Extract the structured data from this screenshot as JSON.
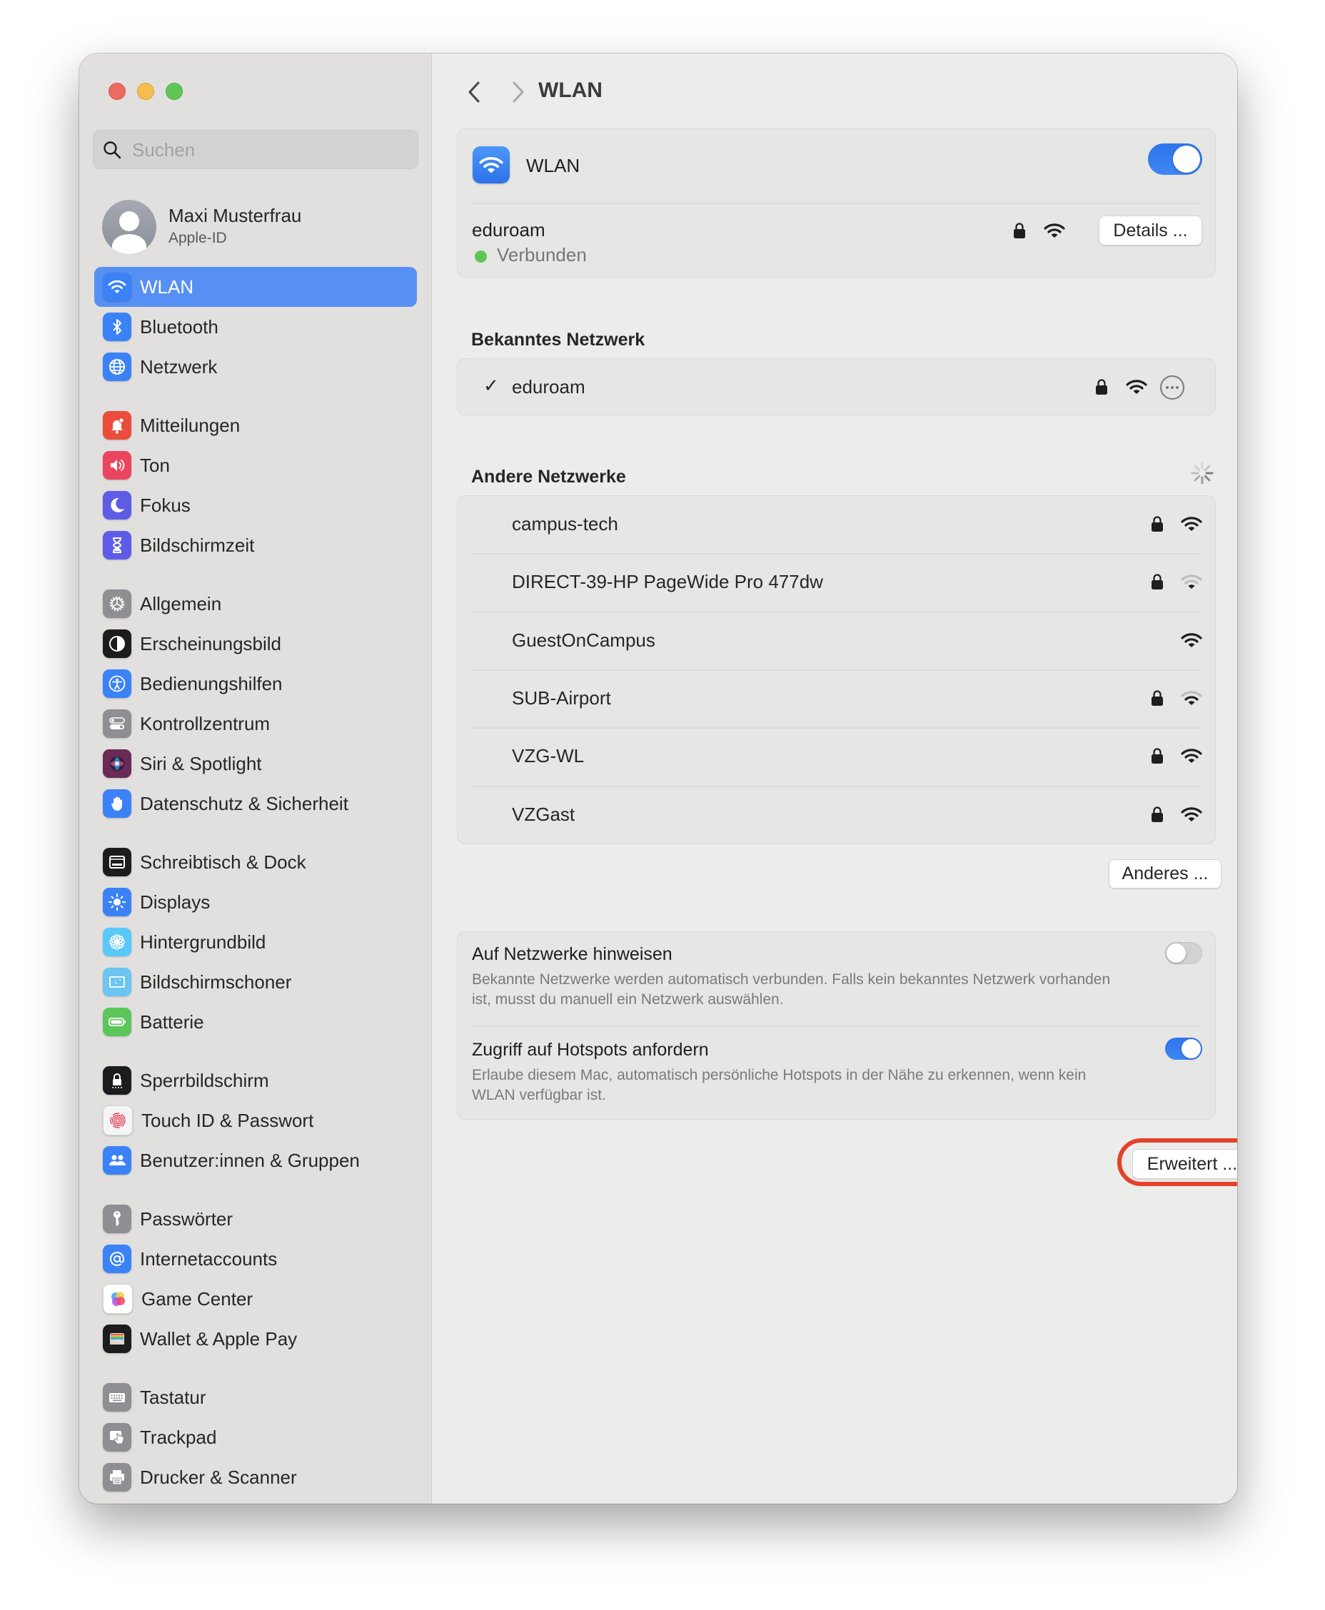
{
  "window": {
    "traffic_lights": [
      "close",
      "minimize",
      "zoom"
    ]
  },
  "sidebar": {
    "search_placeholder": "Suchen",
    "search_value": "",
    "profile": {
      "name": "Maxi Musterfrau",
      "subtitle": "Apple-ID"
    },
    "groups": [
      [
        {
          "label": "WLAN",
          "icon": "wifi-icon",
          "color": "#3B82F6",
          "selected": true
        },
        {
          "label": "Bluetooth",
          "icon": "bluetooth-icon",
          "color": "#3B82F6"
        },
        {
          "label": "Netzwerk",
          "icon": "globe-icon",
          "color": "#3B82F6"
        }
      ],
      [
        {
          "label": "Mitteilungen",
          "icon": "bell-icon",
          "color": "#EB4D3D"
        },
        {
          "label": "Ton",
          "icon": "speaker-icon",
          "color": "#EB4560"
        },
        {
          "label": "Fokus",
          "icon": "moon-icon",
          "color": "#5E5CE6"
        },
        {
          "label": "Bildschirmzeit",
          "icon": "hourglass-icon",
          "color": "#5E5CE6"
        }
      ],
      [
        {
          "label": "Allgemein",
          "icon": "gear-icon",
          "color": "#8E8E93"
        },
        {
          "label": "Erscheinungsbild",
          "icon": "appearance-icon",
          "color": "#1C1C1E"
        },
        {
          "label": "Bedienungshilfen",
          "icon": "accessibility-icon",
          "color": "#3B82F6"
        },
        {
          "label": "Kontrollzentrum",
          "icon": "control-center-icon",
          "color": "#8E8E93"
        },
        {
          "label": "Siri & Spotlight",
          "icon": "siri-icon",
          "color": "#6B2A55"
        },
        {
          "label": "Datenschutz & Sicherheit",
          "icon": "hand-icon",
          "color": "#3B82F6"
        }
      ],
      [
        {
          "label": "Schreibtisch & Dock",
          "icon": "dock-icon",
          "color": "#1C1C1E"
        },
        {
          "label": "Displays",
          "icon": "sun-icon",
          "color": "#3B82F6"
        },
        {
          "label": "Hintergrundbild",
          "icon": "flower-icon",
          "color": "#5AC8FA"
        },
        {
          "label": "Bildschirmschoner",
          "icon": "screensaver-icon",
          "color": "#6CC5F0"
        },
        {
          "label": "Batterie",
          "icon": "battery-icon",
          "color": "#5DC65A"
        }
      ],
      [
        {
          "label": "Sperrbildschirm",
          "icon": "lock-screen-icon",
          "color": "#1C1C1E"
        },
        {
          "label": "Touch ID & Passwort",
          "icon": "fingerprint-icon",
          "color": "#F5F5F5"
        },
        {
          "label": "Benutzer:innen & Gruppen",
          "icon": "users-icon",
          "color": "#3B82F6"
        }
      ],
      [
        {
          "label": "Passwörter",
          "icon": "key-icon",
          "color": "#8E8E93"
        },
        {
          "label": "Internetaccounts",
          "icon": "at-icon",
          "color": "#3B82F6"
        },
        {
          "label": "Game Center",
          "icon": "game-center-icon",
          "color": "#FFFFFF"
        },
        {
          "label": "Wallet & Apple Pay",
          "icon": "wallet-icon",
          "color": "#1C1C1E"
        }
      ],
      [
        {
          "label": "Tastatur",
          "icon": "keyboard-icon",
          "color": "#8E8E93"
        },
        {
          "label": "Trackpad",
          "icon": "trackpad-icon",
          "color": "#8E8E93"
        },
        {
          "label": "Drucker & Scanner",
          "icon": "printer-icon",
          "color": "#8E8E93"
        }
      ]
    ]
  },
  "main": {
    "title": "WLAN",
    "wlan_card": {
      "label": "WLAN",
      "enabled": true,
      "current_network": "eduroam",
      "status": "Verbunden",
      "status_color": "#61C554",
      "secured": true,
      "signal_bars": 3,
      "details_label": "Details ..."
    },
    "known_section": {
      "title": "Bekanntes Netzwerk",
      "networks": [
        {
          "name": "eduroam",
          "connected": true,
          "secured": true,
          "signal_bars": 3
        }
      ]
    },
    "other_section": {
      "title": "Andere Netzwerke",
      "scanning": true,
      "networks": [
        {
          "name": "campus-tech",
          "secured": true,
          "signal_bars": 3
        },
        {
          "name": "DIRECT-39-HP PageWide Pro 477dw",
          "secured": true,
          "signal_bars": 1
        },
        {
          "name": "GuestOnCampus",
          "secured": false,
          "signal_bars": 3
        },
        {
          "name": "SUB-Airport",
          "secured": true,
          "signal_bars": 2
        },
        {
          "name": "VZG-WL",
          "secured": true,
          "signal_bars": 3
        },
        {
          "name": "VZGast",
          "secured": true,
          "signal_bars": 3
        }
      ],
      "other_button": "Anderes ..."
    },
    "settings": [
      {
        "title": "Auf Netzwerke hinweisen",
        "description": "Bekannte Netzwerke werden automatisch verbunden. Falls kein bekanntes Netzwerk vorhanden ist, musst du manuell ein Netzwerk auswählen.",
        "enabled": false
      },
      {
        "title": "Zugriff auf Hotspots anfordern",
        "description": "Erlaube diesem Mac, automatisch persönliche Hotspots in der Nähe zu erkennen, wenn kein WLAN verfügbar ist.",
        "enabled": true
      }
    ],
    "advanced_button": "Erweitert ...",
    "help_button": "?",
    "highlight_color": "#E4412C"
  }
}
